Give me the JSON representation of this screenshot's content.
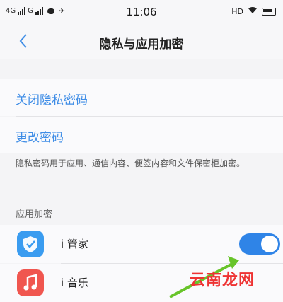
{
  "status_bar": {
    "network_left": "4G",
    "network_mid": "G",
    "time": "11:06",
    "hd": "HD"
  },
  "nav": {
    "title": "隐私与应用加密"
  },
  "settings": {
    "close_privacy_password": "关闭隐私密码",
    "change_password": "更改密码",
    "note": "隐私密码用于应用、通信内容、便签内容和文件保密柜加密。"
  },
  "app_encryption": {
    "section_label": "应用加密",
    "apps": [
      {
        "label": "i 管家",
        "icon": "shield-icon",
        "enabled": true
      },
      {
        "label": "i 音乐",
        "icon": "music-note-icon",
        "enabled": false
      }
    ]
  },
  "watermark": "云南龙网",
  "colors": {
    "accent": "#3f8de6",
    "toggle_on": "#2f84e7",
    "shield_app": "#3a9cf0",
    "music_app": "#f0564f"
  }
}
